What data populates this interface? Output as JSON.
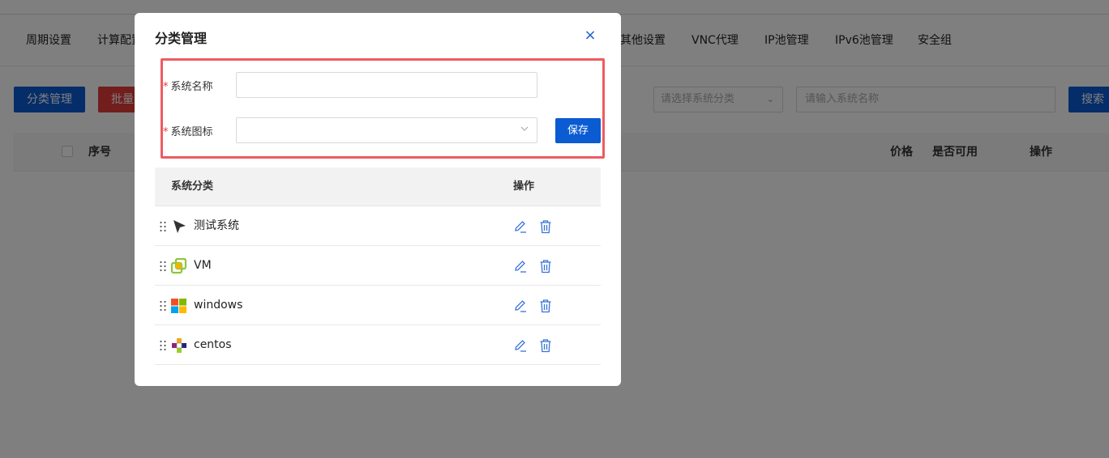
{
  "nav": {
    "items": [
      "周期设置",
      "计算配置",
      "其他设置",
      "VNC代理",
      "IP池管理",
      "IPv6池管理",
      "安全组"
    ]
  },
  "toolbar": {
    "category_button": "分类管理",
    "batch_button": "批量",
    "filter_placeholder": "请选择系统分类",
    "search_placeholder": "请输入系统名称",
    "search_button": "搜索"
  },
  "bg_table": {
    "headers": [
      "序号",
      "价格",
      "是否可用",
      "操作"
    ]
  },
  "modal": {
    "title": "分类管理",
    "close": "×",
    "form": {
      "required_mark": "*",
      "name_label": "系统名称",
      "name_value": "",
      "icon_label": "系统图标",
      "icon_value": "",
      "save_label": "保存"
    },
    "table": {
      "headers": [
        "系统分类",
        "操作"
      ],
      "rows": [
        {
          "name": "测试系统",
          "icon": "cursor-arrow-icon"
        },
        {
          "name": "VM",
          "icon": "vmware-icon"
        },
        {
          "name": "windows",
          "icon": "windows-icon"
        },
        {
          "name": "centos",
          "icon": "centos-icon"
        }
      ]
    }
  },
  "colors": {
    "primary": "#0b5bd3",
    "danger": "#e23c39",
    "highlight": "#ee5b61"
  }
}
